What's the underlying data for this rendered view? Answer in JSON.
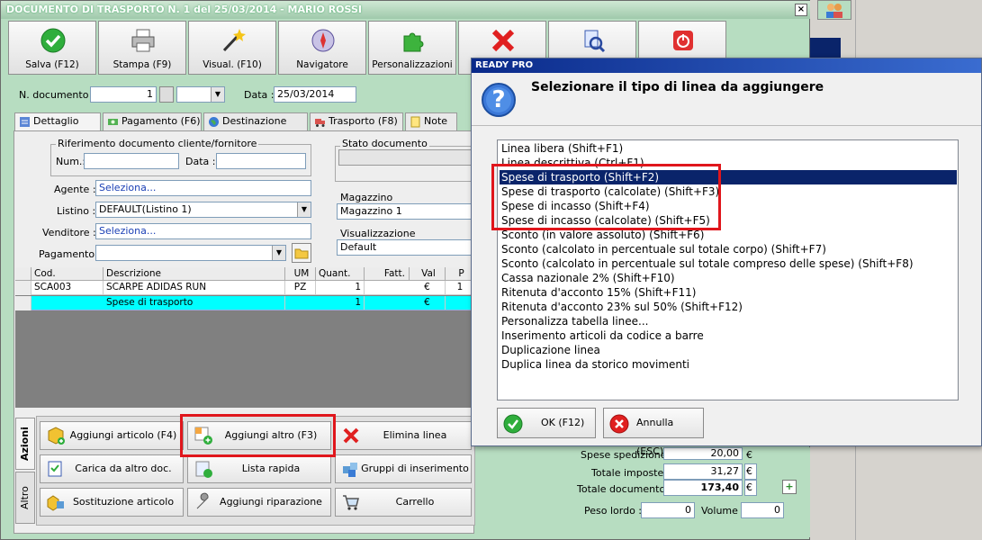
{
  "window": {
    "title": "DOCUMENTO DI TRASPORTO N. 1 del 25/03/2014 - MARIO ROSSI",
    "close_label": "×"
  },
  "toolbar": [
    {
      "label": "Salva (F12)",
      "icon": "check-icon"
    },
    {
      "label": "Stampa (F9)",
      "icon": "printer-icon"
    },
    {
      "label": "Visual. (F10)",
      "icon": "magic-wand-icon"
    },
    {
      "label": "Navigatore",
      "icon": "compass-icon"
    },
    {
      "label": "Personalizzazioni",
      "icon": "puzzle-icon"
    },
    {
      "label": "",
      "icon": "delete-x-icon"
    },
    {
      "label": "",
      "icon": "search-document-icon"
    },
    {
      "label": "",
      "icon": "power-icon"
    }
  ],
  "header": {
    "ndoc_label": "N. documento :",
    "ndoc_value": "1",
    "data_label": "Data :",
    "data_value": "25/03/2014",
    "dropdown_arrow": "▼"
  },
  "tabs": [
    {
      "label": "Dettaglio (F5)",
      "icon": "list-icon"
    },
    {
      "label": "Pagamento (F6)",
      "icon": "money-icon"
    },
    {
      "label": "Destinazione (F7)",
      "icon": "globe-icon"
    },
    {
      "label": "Trasporto (F8)",
      "icon": "truck-icon"
    },
    {
      "label": "Note",
      "icon": "note-icon"
    }
  ],
  "form": {
    "rif_title": "Riferimento documento cliente/fornitore",
    "num_label": "Num.:",
    "data_label": "Data :",
    "agente_label": "Agente :",
    "agente_value": "Seleziona...",
    "listino_label": "Listino :",
    "listino_value": "DEFAULT(Listino 1)",
    "venditore_label": "Venditore :",
    "venditore_value": "Seleziona...",
    "pagamento_label": "Pagamento :",
    "stato_label": "Stato documento",
    "magazzino_label": "Magazzino",
    "magazzino_value": "Magazzino 1",
    "visual_label": "Visualizzazione",
    "visual_value": "Default"
  },
  "grid": {
    "columns": [
      "Cod.",
      "Descrizione",
      "UM",
      "Quant.",
      "Fatt.",
      "Val",
      "P"
    ],
    "rows": [
      [
        "SCA003",
        "SCARPE ADIDAS RUN",
        "PZ",
        "1",
        "",
        "€",
        "1"
      ],
      [
        "",
        "Spese di trasporto",
        "",
        "1",
        "",
        "€",
        ""
      ]
    ]
  },
  "actions": {
    "side_tab_1": "Azioni",
    "side_tab_2": "Altro",
    "buttons": [
      {
        "label": "Aggiungi articolo (F4)",
        "icon": "add-article-icon"
      },
      {
        "label": "Aggiungi altro (F3)",
        "icon": "add-other-icon"
      },
      {
        "label": "Elimina linea",
        "icon": "delete-line-icon"
      },
      {
        "label": "Carica da altro doc.",
        "icon": "load-doc-icon"
      },
      {
        "label": "Lista rapida",
        "icon": "quick-list-icon"
      },
      {
        "label": "Gruppi di inserimento",
        "icon": "groups-icon"
      },
      {
        "label": "Sostituzione articolo",
        "icon": "replace-icon"
      },
      {
        "label": "Aggiungi riparazione",
        "icon": "wrench-icon"
      },
      {
        "label": "Carrello",
        "icon": "cart-icon"
      }
    ]
  },
  "totals": {
    "spese_label": "Spese spedizione :",
    "spese_value": "20,00",
    "imposte_label": "Totale imposte :",
    "imposte_value": "31,27",
    "documento_label": "Totale documento :",
    "documento_value": "173,40",
    "currency": "€",
    "peso_label": "Peso lordo :",
    "peso_value": "0",
    "volume_label": "Volume :",
    "volume_value": "0",
    "plus_label": "+"
  },
  "dialog": {
    "title": "READY PRO",
    "question_glyph": "?",
    "heading": "Selezionare il tipo di linea da aggiungere",
    "items": [
      "Linea libera (Shift+F1)",
      "Linea descrittiva (Ctrl+F1)",
      "Spese di trasporto (Shift+F2)",
      "Spese di trasporto (calcolate) (Shift+F3)",
      "Spese di incasso (Shift+F4)",
      "Spese di incasso (calcolate) (Shift+F5)",
      "Sconto (in valore assoluto) (Shift+F6)",
      "Sconto (calcolato in percentuale sul totale corpo) (Shift+F7)",
      "Sconto (calcolato in percentuale sul totale compreso delle spese) (Shift+F8)",
      "Cassa nazionale 2% (Shift+F10)",
      "Ritenuta d'acconto 15% (Shift+F11)",
      "Ritenuta d'acconto 23% sul 50% (Shift+F12)",
      "Personalizza tabella linee...",
      "Inserimento articoli da codice a barre",
      "Duplicazione linea",
      "Duplica linea da storico movimenti"
    ],
    "ok_label": "OK (F12)",
    "cancel_label": "Annulla (ESC)"
  },
  "colors": {
    "highlight": "#e0161c",
    "selection": "#0a246a",
    "window_bg": "#b7ddc1",
    "cyan_row": "#00ffff"
  }
}
